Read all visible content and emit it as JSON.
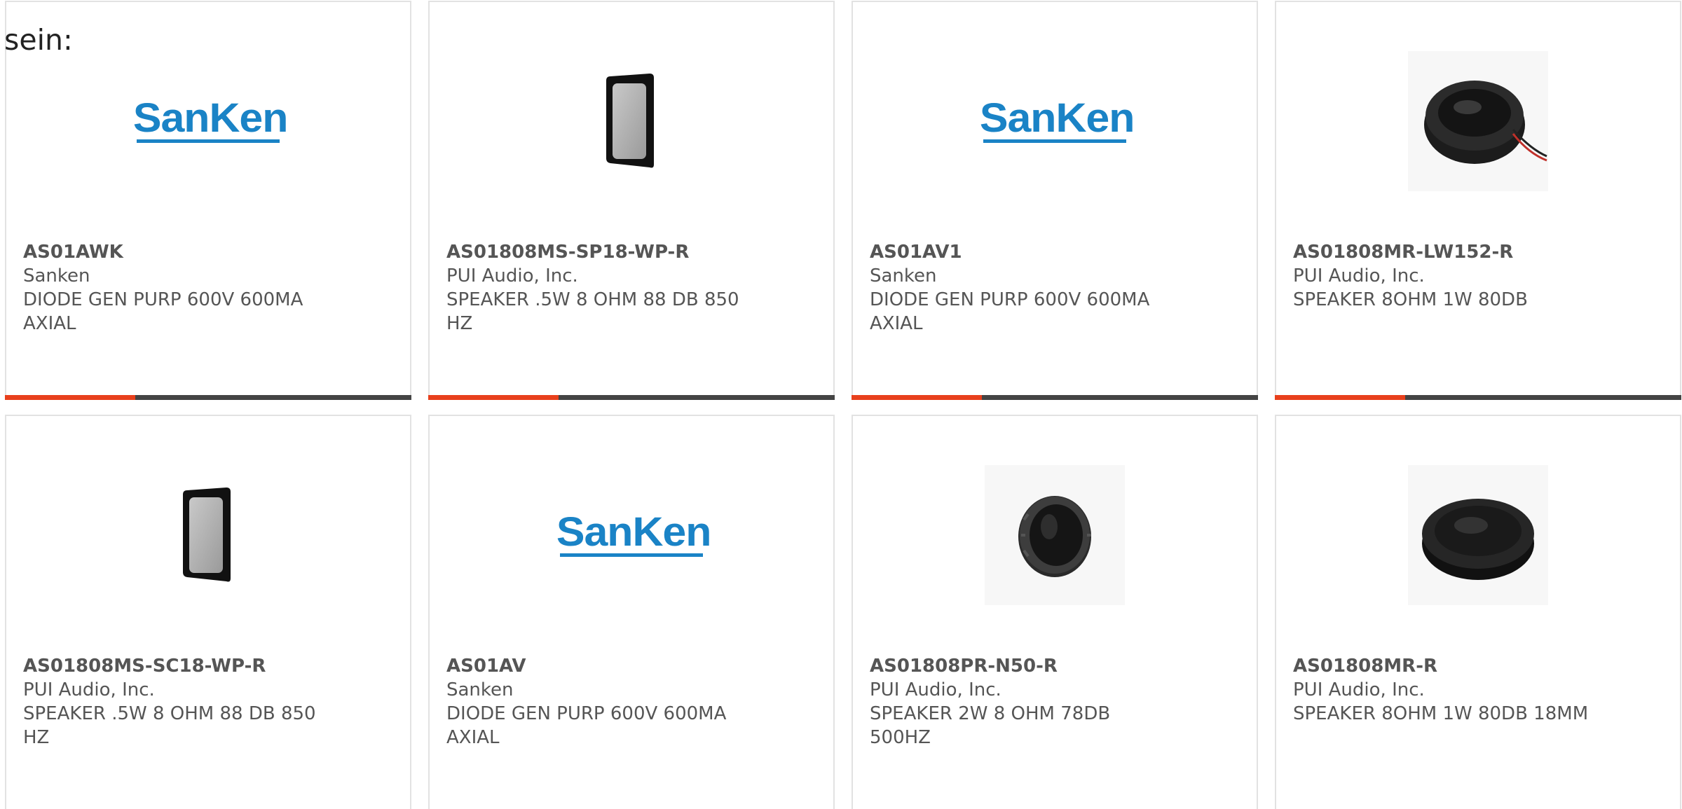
{
  "intro": {
    "text": "sein:"
  },
  "brand_colors": {
    "accent": "#e8401c",
    "bar": "#444444",
    "sanken_blue": "#1a83c6"
  },
  "products": [
    {
      "part_number": "AS01AWK",
      "manufacturer": "Sanken",
      "description": "DIODE GEN PURP 600V 600MA AXIAL",
      "image": "sanken-logo",
      "logo_text": "SanKen"
    },
    {
      "part_number": "AS01808MS-SP18-WP-R",
      "manufacturer": "PUI Audio, Inc.",
      "description": "SPEAKER .5W 8 OHM 88 DB 850 HZ",
      "image": "rectangular-speaker-icon"
    },
    {
      "part_number": "AS01AV1",
      "manufacturer": "Sanken",
      "description": "DIODE GEN PURP 600V 600MA AXIAL",
      "image": "sanken-logo",
      "logo_text": "SanKen"
    },
    {
      "part_number": "AS01808MR-LW152-R",
      "manufacturer": "PUI Audio, Inc.",
      "description": "SPEAKER 8OHM 1W 80DB",
      "image": "round-speaker-with-leads-icon"
    },
    {
      "part_number": "AS01808MS-SC18-WP-R",
      "manufacturer": "PUI Audio, Inc.",
      "description": "SPEAKER .5W 8 OHM 88 DB 850 HZ",
      "image": "rectangular-speaker-icon"
    },
    {
      "part_number": "AS01AV",
      "manufacturer": "Sanken",
      "description": "DIODE GEN PURP 600V 600MA AXIAL",
      "image": "sanken-logo",
      "logo_text": "SanKen"
    },
    {
      "part_number": "AS01808PR-N50-R",
      "manufacturer": "PUI Audio, Inc.",
      "description": "SPEAKER 2W 8 OHM 78DB 500HZ",
      "image": "round-speaker-icon"
    },
    {
      "part_number": "AS01808MR-R",
      "manufacturer": "PUI Audio, Inc.",
      "description": "SPEAKER 8OHM 1W 80DB 18MM",
      "image": "round-speaker-icon"
    }
  ]
}
